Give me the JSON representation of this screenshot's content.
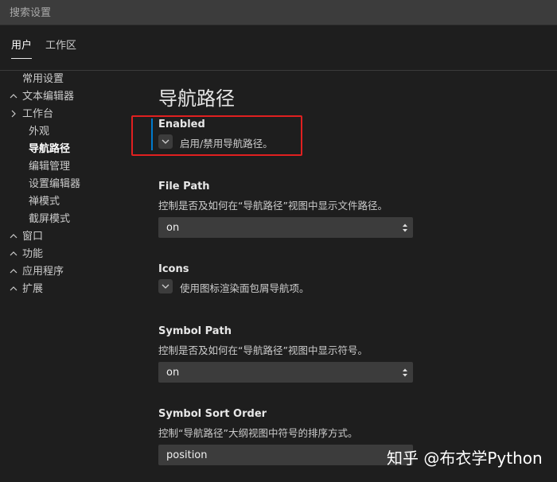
{
  "search": {
    "placeholder": "搜索设置"
  },
  "tabs": [
    {
      "label": "用户",
      "active": true
    },
    {
      "label": "工作区",
      "active": false
    }
  ],
  "nav": {
    "items": [
      {
        "label": "常用设置",
        "chevron": "none"
      },
      {
        "label": "文本编辑器",
        "chevron": "up"
      },
      {
        "label": "工作台",
        "chevron": "right"
      },
      {
        "label": "外观",
        "chevron": "child"
      },
      {
        "label": "导航路径",
        "chevron": "child",
        "selected": true
      },
      {
        "label": "编辑管理",
        "chevron": "child"
      },
      {
        "label": "设置编辑器",
        "chevron": "child"
      },
      {
        "label": "禅模式",
        "chevron": "child"
      },
      {
        "label": "截屏模式",
        "chevron": "child"
      },
      {
        "label": "窗口",
        "chevron": "up"
      },
      {
        "label": "功能",
        "chevron": "up"
      },
      {
        "label": "应用程序",
        "chevron": "up"
      },
      {
        "label": "扩展",
        "chevron": "up"
      }
    ]
  },
  "page": {
    "title": "导航路径"
  },
  "settings": {
    "enabled": {
      "title": "Enabled",
      "label": "启用/禁用导航路径。",
      "checked": true
    },
    "file_path": {
      "title": "File Path",
      "desc": "控制是否及如何在“导航路径”视图中显示文件路径。",
      "value": "on"
    },
    "icons": {
      "title": "Icons",
      "label": "使用图标渲染面包屑导航项。",
      "checked": true
    },
    "symbol_path": {
      "title": "Symbol Path",
      "desc": "控制是否及如何在“导航路径”视图中显示符号。",
      "value": "on"
    },
    "symbol_sort_order": {
      "title": "Symbol Sort Order",
      "desc": "控制“导航路径”大纲视图中符号的排序方式。",
      "value": "position"
    }
  },
  "watermark": {
    "text": "知乎 @布衣学Python"
  },
  "colors": {
    "background": "#1e1e1e",
    "input": "#3c3c3c",
    "accent": "#007acc",
    "highlight": "#e02020"
  }
}
